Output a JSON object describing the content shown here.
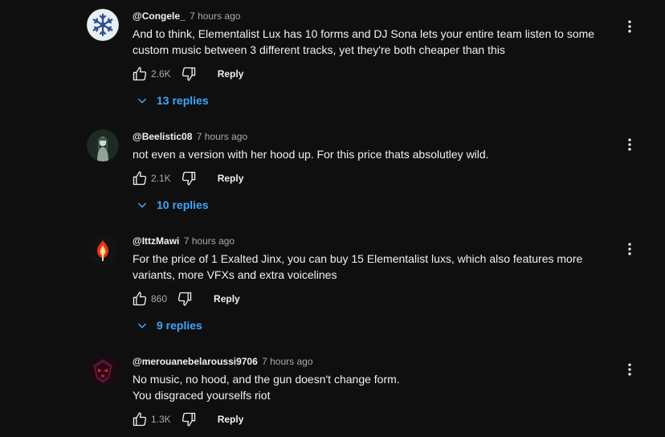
{
  "comments": [
    {
      "author": "@Congele_",
      "time": "7 hours ago",
      "lines": [
        "And to think, Elementalist Lux has 10 forms and DJ Sona lets your entire team listen to some",
        "custom music between 3 different tracks, yet they're both cheaper than this"
      ],
      "likes": "2.6K",
      "reply_label": "Reply",
      "replies_label": "13 replies",
      "avatar_icon": "snowflake-avatar"
    },
    {
      "author": "@Beelistic08",
      "time": "7 hours ago",
      "lines": [
        "not even a version with her hood up. For this price thats absolutley wild."
      ],
      "likes": "2.1K",
      "reply_label": "Reply",
      "replies_label": "10 replies",
      "avatar_icon": "character-avatar"
    },
    {
      "author": "@IttzMawi",
      "time": "7 hours ago",
      "lines": [
        "For the price of 1 Exalted Jinx, you can buy 15 Elementalist luxs, which also features more",
        "variants, more VFXs and extra voicelines"
      ],
      "likes": "860",
      "reply_label": "Reply",
      "replies_label": "9 replies",
      "avatar_icon": "flame-heart-avatar"
    },
    {
      "author": "@merouanebelaroussi9706",
      "time": "7 hours ago",
      "lines": [
        "No music, no hood, and the gun doesn't change form.",
        "You disgraced yourselfs riot"
      ],
      "likes": "1.3K",
      "reply_label": "Reply",
      "avatar_icon": "demon-mask-avatar"
    }
  ],
  "colors": {
    "background": "#0f0f0f",
    "text": "#f1f1f1",
    "secondary": "#aaaaaa",
    "link": "#3ea6ff"
  }
}
